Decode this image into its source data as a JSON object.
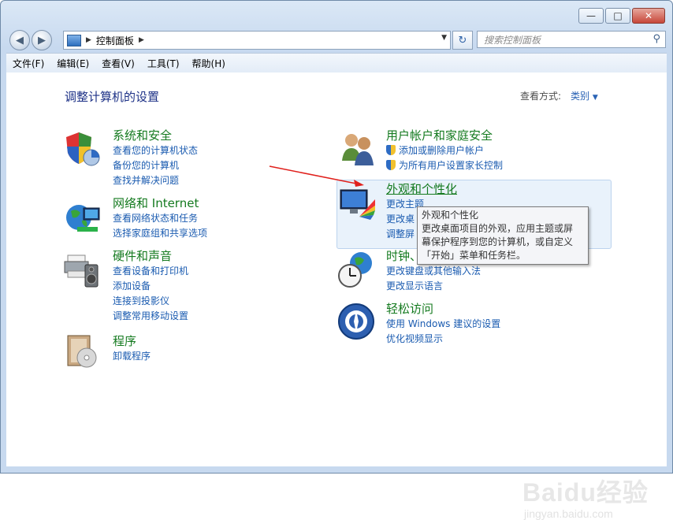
{
  "window": {
    "minimize_label": "—",
    "maximize_label": "□",
    "close_label": "✕"
  },
  "address": {
    "back_label": "◀",
    "forward_label": "▶",
    "crumb": "控制面板",
    "search_placeholder": "搜索控制面板"
  },
  "menu": [
    "文件(F)",
    "编辑(E)",
    "查看(V)",
    "工具(T)",
    "帮助(H)"
  ],
  "page": {
    "title": "调整计算机的设置",
    "view_by_label": "查看方式:",
    "view_by_value": "类别"
  },
  "categories": [
    {
      "title": "系统和安全",
      "links": [
        "查看您的计算机状态",
        "备份您的计算机",
        "查找并解决问题"
      ]
    },
    {
      "title": "网络和 Internet",
      "links": [
        "查看网络状态和任务",
        "选择家庭组和共享选项"
      ]
    },
    {
      "title": "硬件和声音",
      "links": [
        "查看设备和打印机",
        "添加设备",
        "连接到投影仪",
        "调整常用移动设置"
      ]
    },
    {
      "title": "程序",
      "links": [
        "卸载程序"
      ]
    },
    {
      "title": "用户帐户和家庭安全",
      "links": [
        "添加或删除用户帐户",
        "为所有用户设置家长控制"
      ]
    },
    {
      "title": "外观和个性化",
      "links": [
        "更改主题",
        "更改桌",
        "调整屏"
      ]
    },
    {
      "title": "时钟、",
      "links": [
        "更改键盘或其他输入法",
        "更改显示语言"
      ]
    },
    {
      "title": "轻松访问",
      "links": [
        "使用 Windows 建议的设置",
        "优化视频显示"
      ]
    }
  ],
  "tooltip": {
    "title": "外观和个性化",
    "line1": "更改桌面项目的外观，应用主题或屏",
    "line2": "幕保护程序到您的计算机，或自定义",
    "line3": "「开始」菜单和任务栏。"
  },
  "watermark": {
    "main": "Baidu经验",
    "sub": "jingyan.baidu.com"
  },
  "colors": {
    "category_title": "#147a1f",
    "link": "#1a5bb0",
    "page_title": "#1e3287",
    "annotation_arrow": "#e0201c"
  }
}
